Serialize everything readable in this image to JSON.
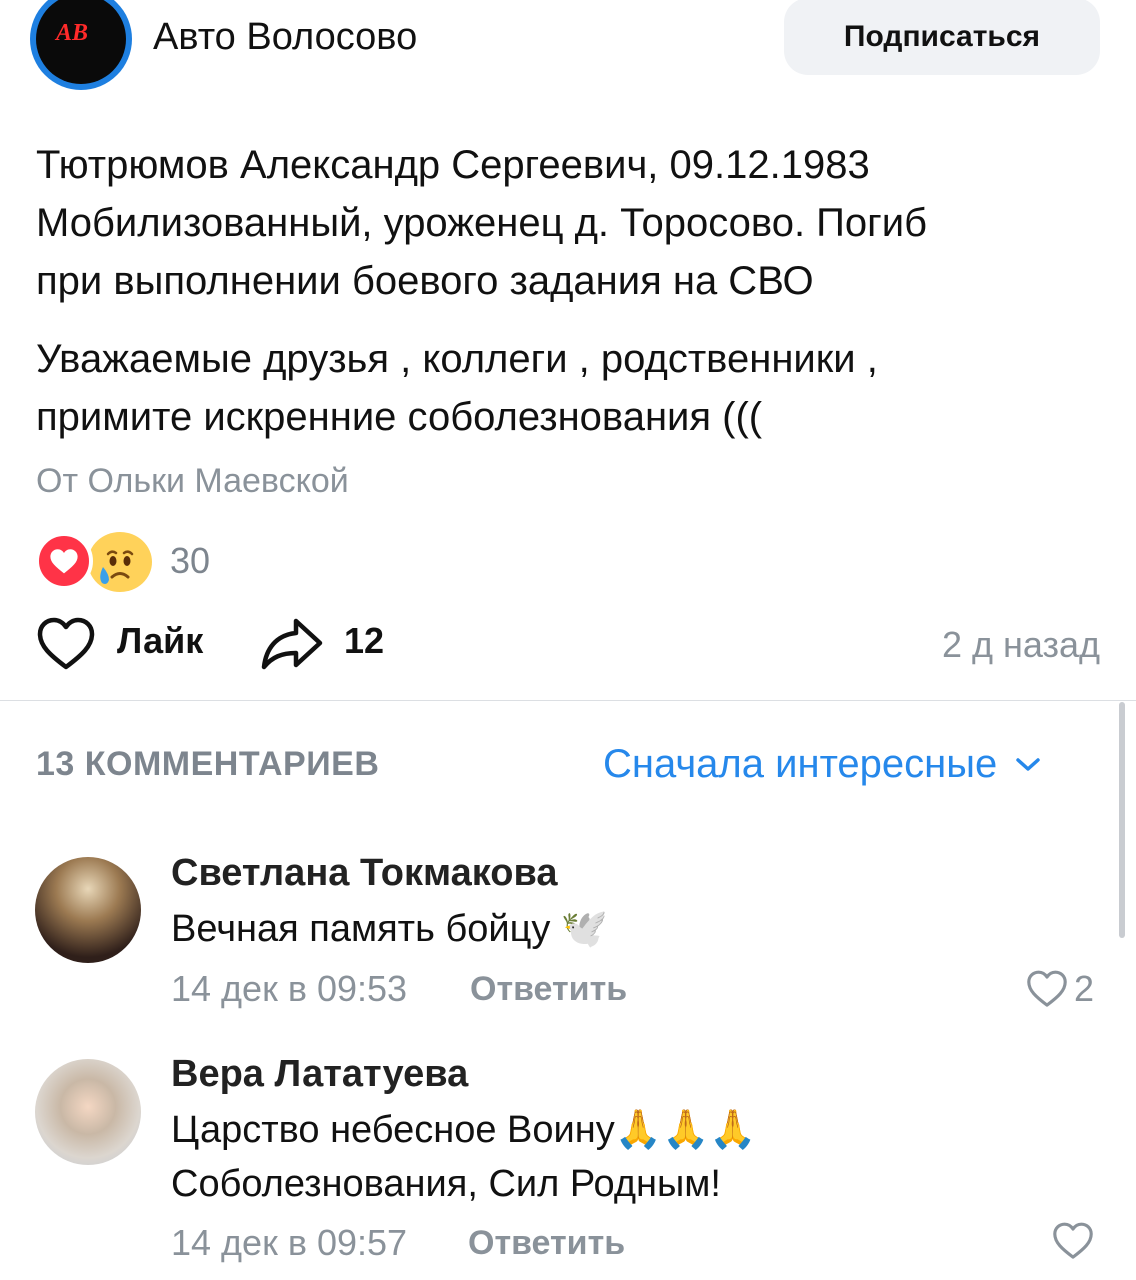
{
  "post": {
    "group_name": "Авто Волосово",
    "logo_text": "AB",
    "subscribe_label": "Подписаться",
    "text_line1": "Тютрюмов Александр Сергеевич, 09.12.1983",
    "text_line2": "Мобилизованный, уроженец д. Торосово. Погиб",
    "text_line3": "при выполнении боевого задания на СВО",
    "text2_line1": "Уважаемые друзья , коллеги , родственники ,",
    "text2_line2": "примите искренние соболезнования (((",
    "author_line": "От Ольки Маевской",
    "reactions_count": "30",
    "like_label": "Лайк",
    "share_count": "12",
    "time": "2 д назад"
  },
  "comments_header": {
    "count_label": "13 КОММЕНТАРИЕВ",
    "sort_label": "Сначала интересные"
  },
  "comments": [
    {
      "author": "Светлана Токмакова",
      "text": "Вечная память бойцу 🕊️",
      "time": "14 дек в 09:53",
      "reply_label": "Ответить",
      "likes": "2"
    },
    {
      "author": "Вера Лататуева",
      "text_line1": "Царство небесное Воину🙏🙏🙏",
      "text_line2": "Соболезнования, Сил Родным!",
      "time": "14 дек в 09:57",
      "reply_label": "Ответить",
      "likes": ""
    }
  ],
  "colors": {
    "accent": "#2688eb",
    "secondary_text": "#8a929a",
    "heart_reaction": "#ff3347"
  }
}
